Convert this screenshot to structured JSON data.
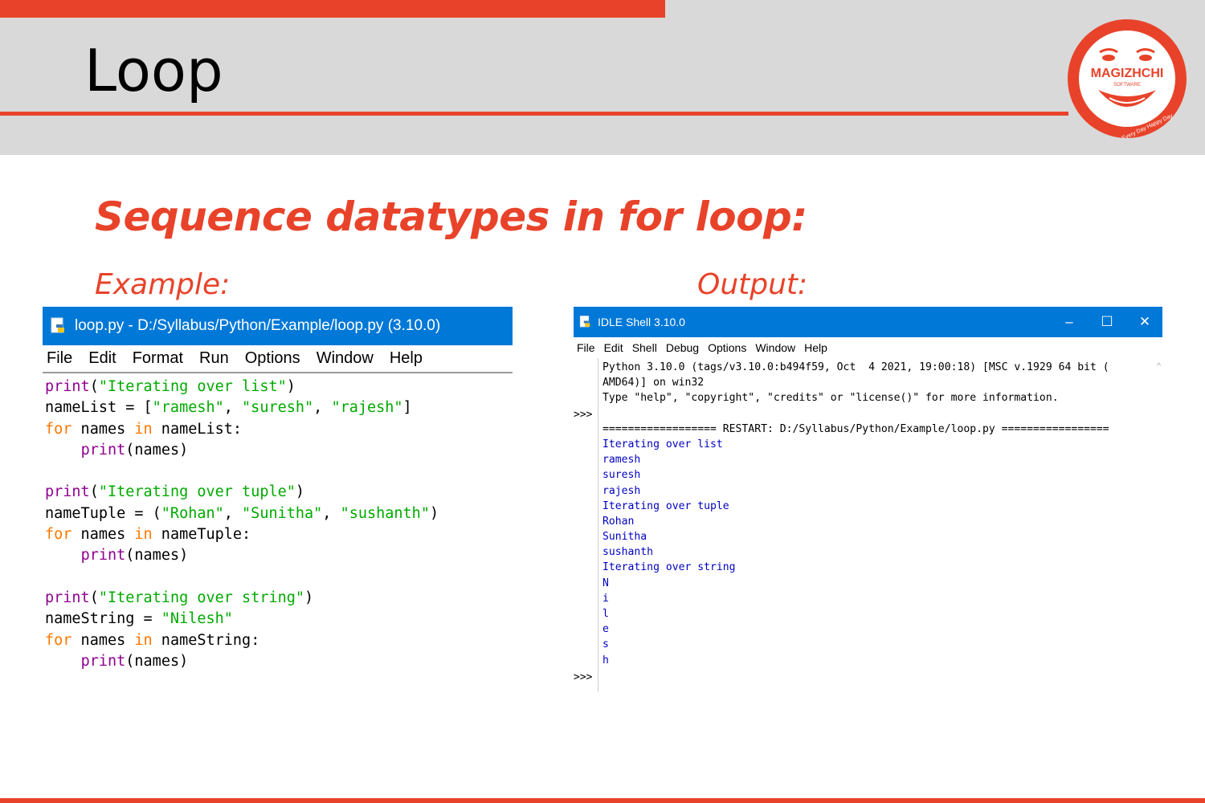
{
  "slide": {
    "title": "Loop",
    "heading": "Sequence datatypes in for loop:",
    "example_label": "Example:",
    "output_label": "Output:"
  },
  "logo": {
    "brand": "MAGIZHCHI",
    "sub": "SOFTWARE",
    "tagline": "Every Day Happy Day"
  },
  "editor": {
    "title": "loop.py - D:/Syllabus/Python/Example/loop.py (3.10.0)",
    "menu": [
      "File",
      "Edit",
      "Format",
      "Run",
      "Options",
      "Window",
      "Help"
    ],
    "code": [
      "print(\"Iterating over list\")",
      "nameList = [\"ramesh\", \"suresh\", \"rajesh\"]",
      "for names in nameList:",
      "    print(names)",
      "",
      "print(\"Iterating over tuple\")",
      "nameTuple = (\"Rohan\", \"Sunitha\", \"sushanth\")",
      "for names in nameTuple:",
      "    print(names)",
      "",
      "print(\"Iterating over string\")",
      "nameString = \"Nilesh\"",
      "for names in nameString:",
      "    print(names)"
    ]
  },
  "shell": {
    "title": "IDLE Shell 3.10.0",
    "controls": {
      "minimize": "–",
      "maximize": "☐",
      "close": "✕"
    },
    "menu": [
      "File",
      "Edit",
      "Shell",
      "Debug",
      "Options",
      "Window",
      "Help"
    ],
    "prompt": ">>>",
    "banner": [
      "Python 3.10.0 (tags/v3.10.0:b494f59, Oct  4 2021, 19:00:18) [MSC v.1929 64 bit (",
      "AMD64)] on win32",
      "Type \"help\", \"copyright\", \"credits\" or \"license()\" for more information."
    ],
    "restart": "================== RESTART: D:/Syllabus/Python/Example/loop.py =================",
    "output": [
      "Iterating over list",
      "ramesh",
      "suresh",
      "rajesh",
      "Iterating over tuple",
      "Rohan",
      "Sunitha",
      "sushanth",
      "Iterating over string",
      "N",
      "i",
      "l",
      "e",
      "s",
      "h"
    ]
  },
  "colors": {
    "accent": "#e8432a",
    "header_band": "#d9d9d9",
    "titlebar": "#0078d7",
    "keyword": "#ff7700",
    "builtin": "#900090",
    "string": "#00aa00",
    "shell_output": "#0000c0"
  }
}
